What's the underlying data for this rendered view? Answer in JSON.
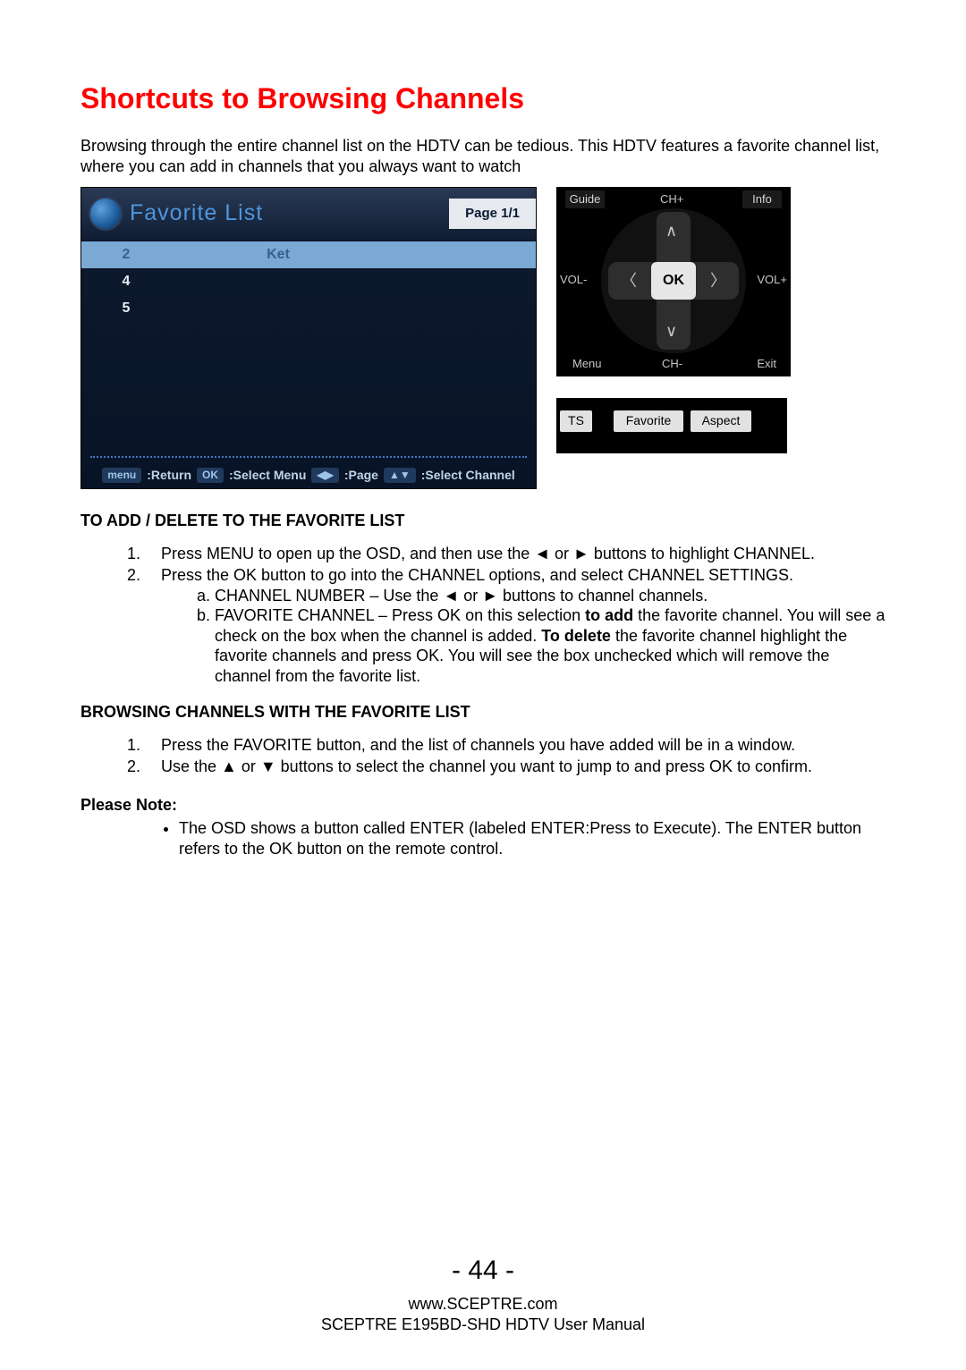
{
  "heading": "Shortcuts to Browsing Channels",
  "intro": "Browsing through the entire channel list on the HDTV can be tedious.  This HDTV features a favorite channel list, where you can add in channels that you always want to watch",
  "osd": {
    "title": "Favorite List",
    "page": "Page 1/1",
    "rows": [
      {
        "num": "2",
        "label": "Ket"
      },
      {
        "num": "4",
        "label": ""
      },
      {
        "num": "5",
        "label": ""
      }
    ],
    "footer": {
      "return": ":Return",
      "select_menu": ":Select Menu",
      "page_hint": ":Page",
      "select_channel": ":Select Channel"
    }
  },
  "remote": {
    "guide": "Guide",
    "ch_plus": "CH+",
    "info": "Info",
    "vol_minus": "VOL-",
    "ok": "OK",
    "vol_plus": "VOL+",
    "menu": "Menu",
    "ch_minus": "CH-",
    "exit": "Exit",
    "ts": "TS",
    "favorite": "Favorite",
    "aspect": "Aspect"
  },
  "section_add": {
    "title": "TO ADD / DELETE TO THE FAVORITE LIST",
    "step1": "Press MENU to open up the OSD, and then use the ◄ or ► buttons to highlight CHANNEL.",
    "step2": "Press the OK button to go into the CHANNEL options, and select CHANNEL SETTINGS.",
    "step2a": "CHANNEL NUMBER – Use the ◄ or ► buttons to channel channels.",
    "step2b_pre": "FAVORITE CHANNEL – Press OK on this selection ",
    "step2b_bold1": "to add",
    "step2b_mid": " the favorite channel.  You will see a check on the box when the channel is added.  ",
    "step2b_bold2": "To delete",
    "step2b_post": " the favorite channel highlight the favorite channels and press OK.  You will see the box unchecked which will remove the channel from the favorite list."
  },
  "section_browse": {
    "title": "BROWSING CHANNELS WITH THE FAVORITE LIST",
    "step1": "Press the FAVORITE button, and the list of channels you have added will be in a window.",
    "step2": "Use the ▲ or ▼ buttons to select the channel you want to jump to and press OK to confirm."
  },
  "note": {
    "label": "Please Note:",
    "text": "The OSD shows a button called ENTER (labeled ENTER:Press to Execute).  The ENTER button refers to the OK button on the remote control."
  },
  "footer": {
    "page": "- 44 -",
    "url": "www.SCEPTRE.com",
    "manual": "SCEPTRE E195BD-SHD HDTV User Manual"
  }
}
